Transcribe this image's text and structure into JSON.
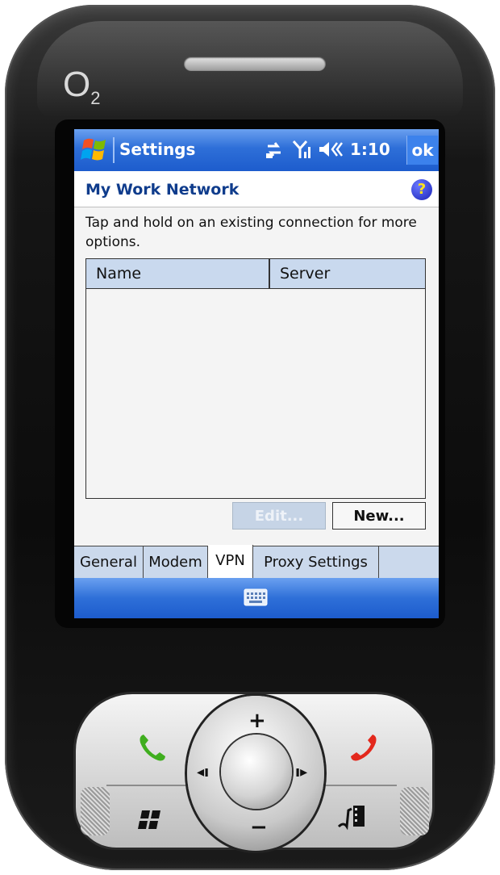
{
  "device": {
    "brand": "O",
    "brand_sub": "2"
  },
  "titlebar": {
    "app_title": "Settings",
    "time": "1:10",
    "ok_label": "ok",
    "icons": [
      "start-flag-icon",
      "connectivity-icon",
      "signal-icon",
      "volume-icon"
    ]
  },
  "header": {
    "title": "My Work Network",
    "help_label": "?"
  },
  "instruction": "Tap and hold on an existing connection for more options.",
  "list": {
    "columns": [
      "Name",
      "Server"
    ],
    "rows": []
  },
  "buttons": {
    "edit": "Edit...",
    "new": "New..."
  },
  "tabs": [
    {
      "label": "General"
    },
    {
      "label": "Modem"
    },
    {
      "label": "VPN",
      "selected": true
    },
    {
      "label": "Proxy Settings"
    }
  ],
  "bottombar": {
    "icon": "keyboard-icon"
  },
  "keypad": {
    "dpad_up": "+",
    "dpad_down": "−",
    "dpad_left": "◂ı",
    "dpad_right": "ı▸"
  },
  "colors": {
    "titlebar_blue": "#2e6fd8",
    "header_text": "#0f3c8c",
    "tab_bg": "#cbd9ec",
    "call_green": "#3fae1e",
    "end_red": "#e3281c"
  }
}
